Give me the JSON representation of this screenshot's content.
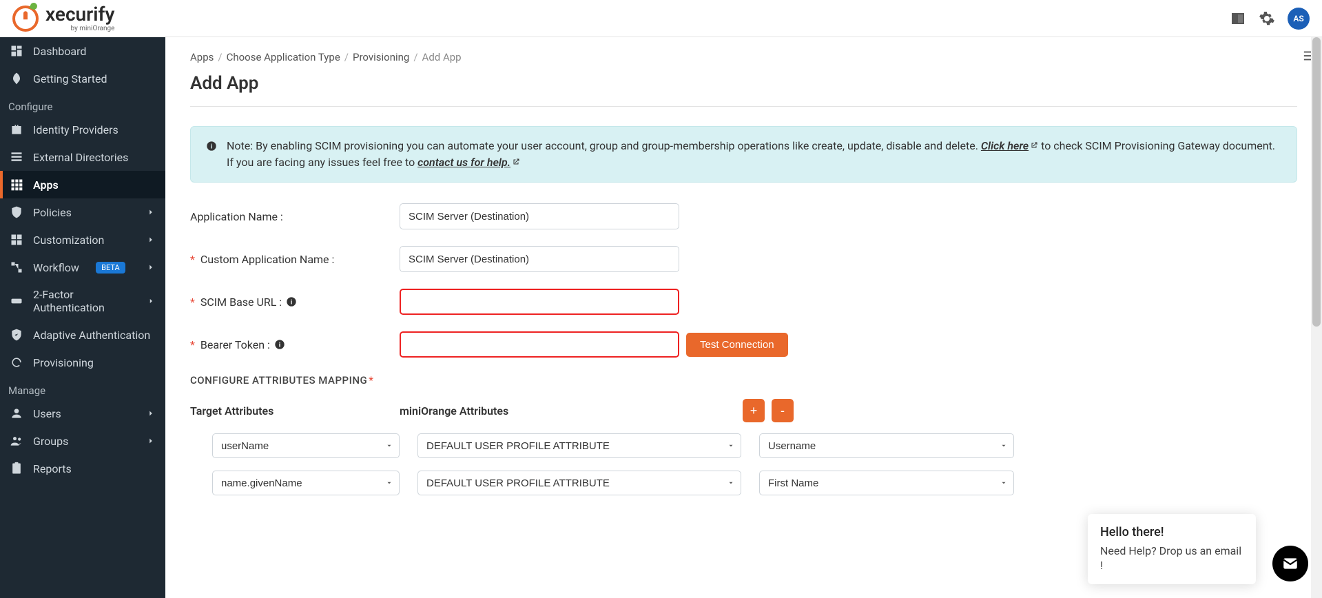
{
  "brand": {
    "main": "xecurify",
    "sub": "by miniOrange"
  },
  "avatar": "AS",
  "sidebar": {
    "dashboard": "Dashboard",
    "getting_started": "Getting Started",
    "configure": "Configure",
    "identity_providers": "Identity Providers",
    "external_directories": "External Directories",
    "apps": "Apps",
    "policies": "Policies",
    "customization": "Customization",
    "workflow": "Workflow",
    "workflow_badge": "BETA",
    "two_factor": "2-Factor Authentication",
    "adaptive": "Adaptive Authentication",
    "provisioning": "Provisioning",
    "manage": "Manage",
    "users": "Users",
    "groups": "Groups",
    "reports": "Reports"
  },
  "crumbs": {
    "apps": "Apps",
    "choose": "Choose Application Type",
    "prov": "Provisioning",
    "add": "Add App"
  },
  "page_title": "Add App",
  "note": {
    "prefix": "Note: By enabling SCIM provisioning you can automate your user account, group and group-membership operations like create, update, disable and delete. ",
    "click_here": "Click here",
    "mid": " to check SCIM Provisioning Gateway document. If you are facing any issues feel free to ",
    "contact": "contact us for help."
  },
  "form": {
    "app_name_label": "Application Name :",
    "app_name_value": "SCIM Server (Destination)",
    "custom_name_label": "Custom Application Name :",
    "custom_name_value": "SCIM Server (Destination)",
    "scim_url_label": " SCIM Base URL : ",
    "bearer_label": " Bearer Token : ",
    "test_btn": "Test Connection"
  },
  "mapping": {
    "header": "CONFIGURE ATTRIBUTES MAPPING",
    "target": "Target Attributes",
    "mini": "miniOrange Attributes",
    "plus": "+",
    "minus": "-",
    "rows": [
      {
        "ta": "userName",
        "mo": "DEFAULT USER PROFILE ATTRIBUTE",
        "extra": "Username"
      },
      {
        "ta": "name.givenName",
        "mo": "DEFAULT USER PROFILE ATTRIBUTE",
        "extra": "First Name"
      }
    ]
  },
  "chat": {
    "hello": "Hello there!",
    "help": "Need Help? Drop us an email !"
  }
}
